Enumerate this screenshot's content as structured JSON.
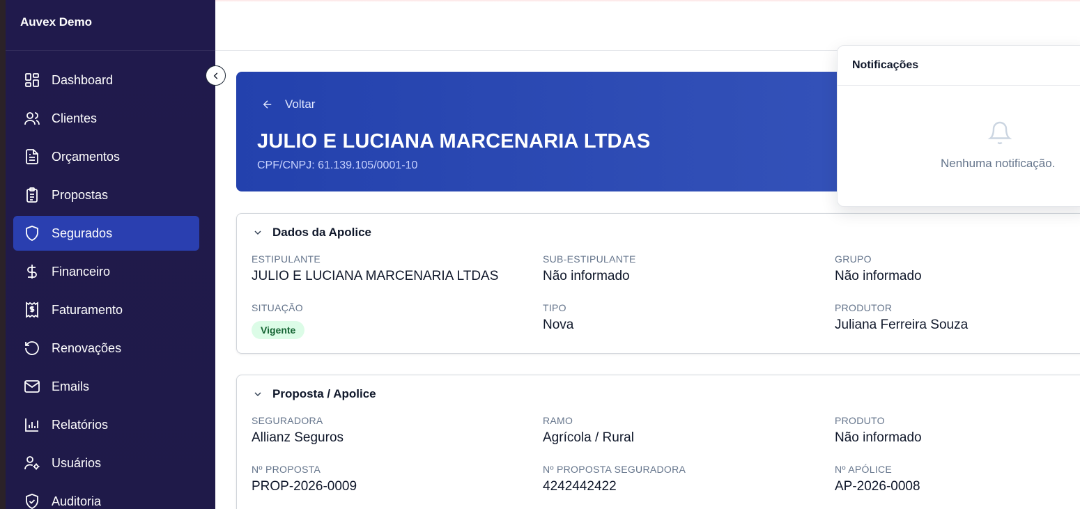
{
  "app": {
    "brand": "Auvex Demo"
  },
  "sidebar": {
    "items": [
      {
        "label": "Dashboard",
        "icon": "dashboard-icon"
      },
      {
        "label": "Clientes",
        "icon": "users-icon"
      },
      {
        "label": "Orçamentos",
        "icon": "document-icon"
      },
      {
        "label": "Propostas",
        "icon": "clipboard-icon"
      },
      {
        "label": "Segurados",
        "icon": "shield-icon",
        "active": true
      },
      {
        "label": "Financeiro",
        "icon": "dollar-icon"
      },
      {
        "label": "Faturamento",
        "icon": "invoice-icon"
      },
      {
        "label": "Renovações",
        "icon": "rotate-icon"
      },
      {
        "label": "Emails",
        "icon": "mail-icon"
      },
      {
        "label": "Relatórios",
        "icon": "bar-chart-icon"
      },
      {
        "label": "Usuários",
        "icon": "user-settings-icon"
      },
      {
        "label": "Auditoria",
        "icon": "shield-check-icon"
      }
    ]
  },
  "hero": {
    "back_label": "Voltar",
    "title": "JULIO E LUCIANA MARCENARIA LTDAS",
    "subtitle": "CPF/CNPJ: 61.139.105/0001-10"
  },
  "apolice": {
    "title": "Dados da Apolice",
    "estipulante_label": "ESTIPULANTE",
    "estipulante": "JULIO E LUCIANA MARCENARIA LTDAS",
    "sub_label": "SUB-ESTIPULANTE",
    "sub": "Não informado",
    "grupo_label": "GRUPO",
    "grupo": "Não informado",
    "situacao_label": "SITUAÇÃO",
    "situacao": "Vigente",
    "tipo_label": "TIPO",
    "tipo": "Nova",
    "produtor_label": "PRODUTOR",
    "produtor": "Juliana Ferreira Souza"
  },
  "proposta": {
    "title": "Proposta / Apolice",
    "seguradora_label": "SEGURADORA",
    "seguradora": "Allianz Seguros",
    "ramo_label": "RAMO",
    "ramo": "Agrícola / Rural",
    "produto_label": "PRODUTO",
    "produto": "Não informado",
    "num_proposta_label": "Nº PROPOSTA",
    "num_proposta": "PROP-2026-0009",
    "num_prop_seg_label": "Nº PROPOSTA SEGURADORA",
    "num_prop_seg": "4242442422",
    "num_apolice_label": "Nº APÓLICE",
    "num_apolice": "AP-2026-0008"
  },
  "notifications": {
    "title": "Notificações",
    "empty_text": "Nenhuma notificação."
  },
  "colors": {
    "sidebar_bg": "#201a4c",
    "active": "#2a3fb0",
    "hero": "#2341ad",
    "badge_bg": "#dcfce7",
    "badge_text": "#166534"
  }
}
